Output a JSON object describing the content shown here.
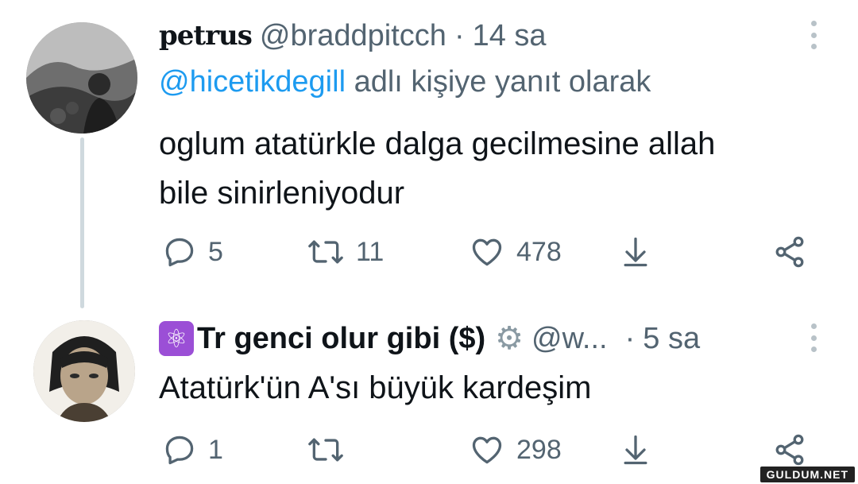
{
  "tweet1": {
    "display_name": "petrus",
    "handle": "@braddpitcch",
    "separator": "·",
    "time": "14 sa",
    "reply_prefix_mention": "@hicetikdegill",
    "reply_suffix": "adlı kişiye yanıt olarak",
    "text_line1": "oglum atatürkle dalga gecilmesine allah",
    "text_line2": "bile sinirleniyodur",
    "replies": "5",
    "retweets": "11",
    "likes": "478",
    "avatar_icon": "profile-photo"
  },
  "tweet2": {
    "badge_emoji": "⚛",
    "display_name": "Tr genci olur gibi ($)",
    "gear_emoji": "⚙",
    "handle": "@w...",
    "separator": "·",
    "time": "5 sa",
    "text": "Atatürk'ün A'sı büyük kardeşim",
    "replies": "1",
    "retweets": "",
    "likes": "298",
    "avatar_icon": "anime-profile-photo"
  },
  "watermark": "GULDUM.NET",
  "colors": {
    "text": "#0f1419",
    "secondary": "#536471",
    "mention": "#1d9bf0",
    "thread_line": "#cfd9de"
  },
  "icons": [
    "reply-icon",
    "retweet-icon",
    "like-icon",
    "download-icon",
    "share-icon",
    "more-icon"
  ]
}
